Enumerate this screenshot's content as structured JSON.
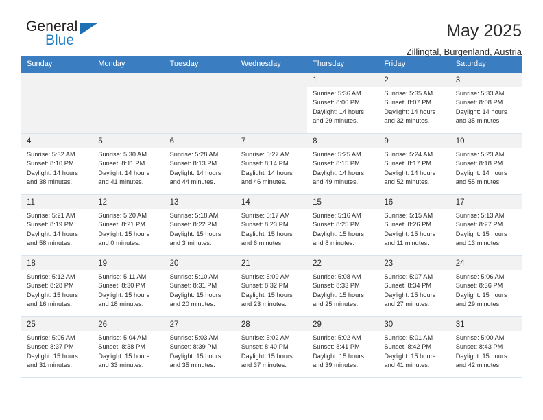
{
  "brand": {
    "name_primary": "General",
    "name_secondary": "Blue",
    "triangle_color": "#1f6fb5"
  },
  "header": {
    "title": "May 2025",
    "subtitle": "Zillingtal, Burgenland, Austria",
    "header_bg_color": "#3a7dc0",
    "header_text_color": "#ffffff"
  },
  "weekday_headers": [
    "Sunday",
    "Monday",
    "Tuesday",
    "Wednesday",
    "Thursday",
    "Friday",
    "Saturday"
  ],
  "labels": {
    "sunrise_prefix": "Sunrise:",
    "sunset_prefix": "Sunset:",
    "daylight_prefix": "Daylight:"
  },
  "weeks": [
    [
      {
        "day": "",
        "line1": "",
        "line2": "",
        "line3": "",
        "line4": "",
        "empty": true
      },
      {
        "day": "",
        "line1": "",
        "line2": "",
        "line3": "",
        "line4": "",
        "empty": true
      },
      {
        "day": "",
        "line1": "",
        "line2": "",
        "line3": "",
        "line4": "",
        "empty": true
      },
      {
        "day": "",
        "line1": "",
        "line2": "",
        "line3": "",
        "line4": "",
        "empty": true
      },
      {
        "day": "1",
        "line1": "Sunrise: 5:36 AM",
        "line2": "Sunset: 8:06 PM",
        "line3": "Daylight: 14 hours",
        "line4": "and 29 minutes."
      },
      {
        "day": "2",
        "line1": "Sunrise: 5:35 AM",
        "line2": "Sunset: 8:07 PM",
        "line3": "Daylight: 14 hours",
        "line4": "and 32 minutes."
      },
      {
        "day": "3",
        "line1": "Sunrise: 5:33 AM",
        "line2": "Sunset: 8:08 PM",
        "line3": "Daylight: 14 hours",
        "line4": "and 35 minutes."
      }
    ],
    [
      {
        "day": "4",
        "line1": "Sunrise: 5:32 AM",
        "line2": "Sunset: 8:10 PM",
        "line3": "Daylight: 14 hours",
        "line4": "and 38 minutes."
      },
      {
        "day": "5",
        "line1": "Sunrise: 5:30 AM",
        "line2": "Sunset: 8:11 PM",
        "line3": "Daylight: 14 hours",
        "line4": "and 41 minutes."
      },
      {
        "day": "6",
        "line1": "Sunrise: 5:28 AM",
        "line2": "Sunset: 8:13 PM",
        "line3": "Daylight: 14 hours",
        "line4": "and 44 minutes."
      },
      {
        "day": "7",
        "line1": "Sunrise: 5:27 AM",
        "line2": "Sunset: 8:14 PM",
        "line3": "Daylight: 14 hours",
        "line4": "and 46 minutes."
      },
      {
        "day": "8",
        "line1": "Sunrise: 5:25 AM",
        "line2": "Sunset: 8:15 PM",
        "line3": "Daylight: 14 hours",
        "line4": "and 49 minutes."
      },
      {
        "day": "9",
        "line1": "Sunrise: 5:24 AM",
        "line2": "Sunset: 8:17 PM",
        "line3": "Daylight: 14 hours",
        "line4": "and 52 minutes."
      },
      {
        "day": "10",
        "line1": "Sunrise: 5:23 AM",
        "line2": "Sunset: 8:18 PM",
        "line3": "Daylight: 14 hours",
        "line4": "and 55 minutes."
      }
    ],
    [
      {
        "day": "11",
        "line1": "Sunrise: 5:21 AM",
        "line2": "Sunset: 8:19 PM",
        "line3": "Daylight: 14 hours",
        "line4": "and 58 minutes."
      },
      {
        "day": "12",
        "line1": "Sunrise: 5:20 AM",
        "line2": "Sunset: 8:21 PM",
        "line3": "Daylight: 15 hours",
        "line4": "and 0 minutes."
      },
      {
        "day": "13",
        "line1": "Sunrise: 5:18 AM",
        "line2": "Sunset: 8:22 PM",
        "line3": "Daylight: 15 hours",
        "line4": "and 3 minutes."
      },
      {
        "day": "14",
        "line1": "Sunrise: 5:17 AM",
        "line2": "Sunset: 8:23 PM",
        "line3": "Daylight: 15 hours",
        "line4": "and 6 minutes."
      },
      {
        "day": "15",
        "line1": "Sunrise: 5:16 AM",
        "line2": "Sunset: 8:25 PM",
        "line3": "Daylight: 15 hours",
        "line4": "and 8 minutes."
      },
      {
        "day": "16",
        "line1": "Sunrise: 5:15 AM",
        "line2": "Sunset: 8:26 PM",
        "line3": "Daylight: 15 hours",
        "line4": "and 11 minutes."
      },
      {
        "day": "17",
        "line1": "Sunrise: 5:13 AM",
        "line2": "Sunset: 8:27 PM",
        "line3": "Daylight: 15 hours",
        "line4": "and 13 minutes."
      }
    ],
    [
      {
        "day": "18",
        "line1": "Sunrise: 5:12 AM",
        "line2": "Sunset: 8:28 PM",
        "line3": "Daylight: 15 hours",
        "line4": "and 16 minutes."
      },
      {
        "day": "19",
        "line1": "Sunrise: 5:11 AM",
        "line2": "Sunset: 8:30 PM",
        "line3": "Daylight: 15 hours",
        "line4": "and 18 minutes."
      },
      {
        "day": "20",
        "line1": "Sunrise: 5:10 AM",
        "line2": "Sunset: 8:31 PM",
        "line3": "Daylight: 15 hours",
        "line4": "and 20 minutes."
      },
      {
        "day": "21",
        "line1": "Sunrise: 5:09 AM",
        "line2": "Sunset: 8:32 PM",
        "line3": "Daylight: 15 hours",
        "line4": "and 23 minutes."
      },
      {
        "day": "22",
        "line1": "Sunrise: 5:08 AM",
        "line2": "Sunset: 8:33 PM",
        "line3": "Daylight: 15 hours",
        "line4": "and 25 minutes."
      },
      {
        "day": "23",
        "line1": "Sunrise: 5:07 AM",
        "line2": "Sunset: 8:34 PM",
        "line3": "Daylight: 15 hours",
        "line4": "and 27 minutes."
      },
      {
        "day": "24",
        "line1": "Sunrise: 5:06 AM",
        "line2": "Sunset: 8:36 PM",
        "line3": "Daylight: 15 hours",
        "line4": "and 29 minutes."
      }
    ],
    [
      {
        "day": "25",
        "line1": "Sunrise: 5:05 AM",
        "line2": "Sunset: 8:37 PM",
        "line3": "Daylight: 15 hours",
        "line4": "and 31 minutes."
      },
      {
        "day": "26",
        "line1": "Sunrise: 5:04 AM",
        "line2": "Sunset: 8:38 PM",
        "line3": "Daylight: 15 hours",
        "line4": "and 33 minutes."
      },
      {
        "day": "27",
        "line1": "Sunrise: 5:03 AM",
        "line2": "Sunset: 8:39 PM",
        "line3": "Daylight: 15 hours",
        "line4": "and 35 minutes."
      },
      {
        "day": "28",
        "line1": "Sunrise: 5:02 AM",
        "line2": "Sunset: 8:40 PM",
        "line3": "Daylight: 15 hours",
        "line4": "and 37 minutes."
      },
      {
        "day": "29",
        "line1": "Sunrise: 5:02 AM",
        "line2": "Sunset: 8:41 PM",
        "line3": "Daylight: 15 hours",
        "line4": "and 39 minutes."
      },
      {
        "day": "30",
        "line1": "Sunrise: 5:01 AM",
        "line2": "Sunset: 8:42 PM",
        "line3": "Daylight: 15 hours",
        "line4": "and 41 minutes."
      },
      {
        "day": "31",
        "line1": "Sunrise: 5:00 AM",
        "line2": "Sunset: 8:43 PM",
        "line3": "Daylight: 15 hours",
        "line4": "and 42 minutes."
      }
    ]
  ]
}
